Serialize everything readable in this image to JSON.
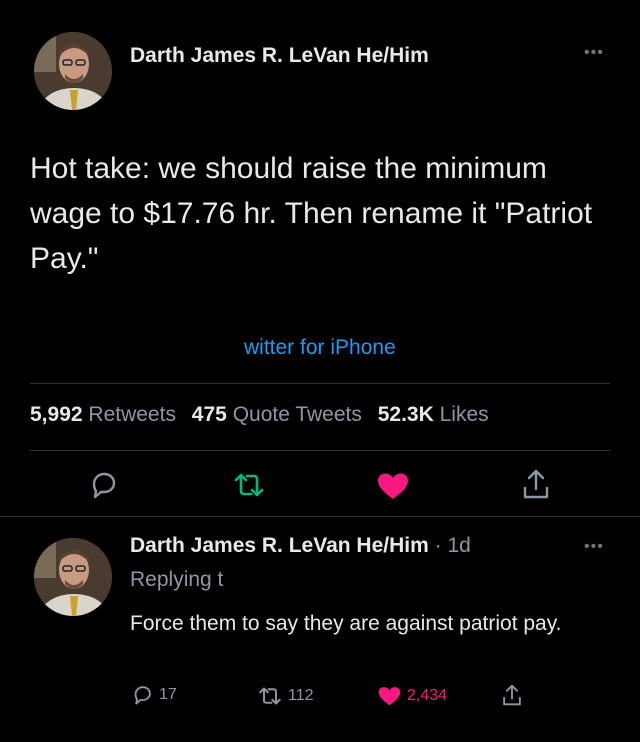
{
  "tweet": {
    "author": "Darth James R. LeVan He/Him",
    "more_icon": "ellipsis-icon",
    "text": "Hot take: we should raise the minimum wage to $17.76 hr. Then rename it \"Patriot Pay.\"",
    "source": "witter for iPhone",
    "stats": {
      "retweets_count": "5,992",
      "retweets_label": "Retweets",
      "quotes_count": "475",
      "quotes_label": "Quote Tweets",
      "likes_count": "52.3K",
      "likes_label": "Likes"
    },
    "actions": {
      "reply_icon": "reply-icon",
      "retweet_icon": "retweet-icon",
      "like_icon": "heart-icon",
      "share_icon": "share-icon"
    }
  },
  "reply": {
    "author": "Darth James R. LeVan He/Him",
    "time": " · 1d",
    "replying_to": "Replying t",
    "text": "Force them to say they are against patriot pay.",
    "counts": {
      "replies": "17",
      "retweets": "112",
      "likes": "2,434"
    }
  },
  "colors": {
    "background": "#000000",
    "text": "#e7e9ea",
    "muted": "#8b98a5",
    "link": "#1d9bf0",
    "retweet_green": "#00ba7c",
    "like_pink": "#f91880"
  }
}
